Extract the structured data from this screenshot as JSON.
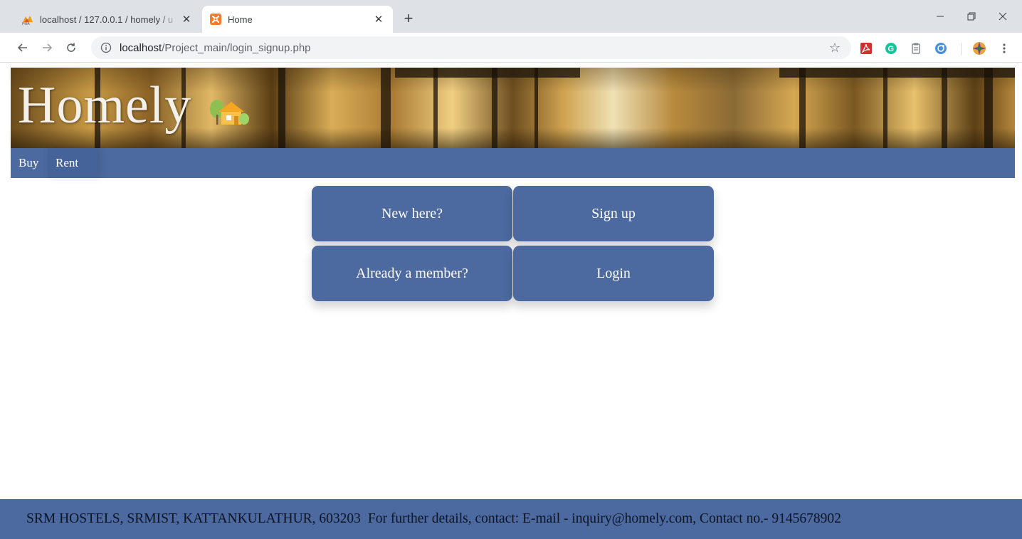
{
  "browser": {
    "tabs": [
      {
        "title": "localhost / 127.0.0.1 / homely / u",
        "favicon": "phpmyadmin-icon",
        "active": false
      },
      {
        "title": "Home",
        "favicon": "xampp-icon",
        "active": true
      }
    ],
    "address": {
      "host": "localhost",
      "path": "/Project_main/login_signup.php"
    },
    "extensions": [
      "acrobat-extension-icon",
      "grammarly-extension-icon",
      "clipboard-extension-icon",
      "sync-extension-icon",
      "profile-avatar-icon"
    ]
  },
  "site": {
    "brand": "Homely",
    "nav": {
      "buy": "Buy",
      "rent": "Rent"
    },
    "choices": {
      "signup": {
        "prompt": "New here?",
        "action": "Sign up"
      },
      "login": {
        "prompt": "Already a member?",
        "action": "Login"
      }
    },
    "footer": {
      "address": "SRM HOSTELS, SRMIST, KATTANKULATHUR, 603203",
      "contact": "For further details, contact: E-mail - inquiry@homely.com, Contact no.- 9145678902"
    }
  },
  "colors": {
    "primary": "#4c69a0",
    "chrome_bg": "#dee1e6",
    "omnibox_bg": "#f1f3f4"
  }
}
